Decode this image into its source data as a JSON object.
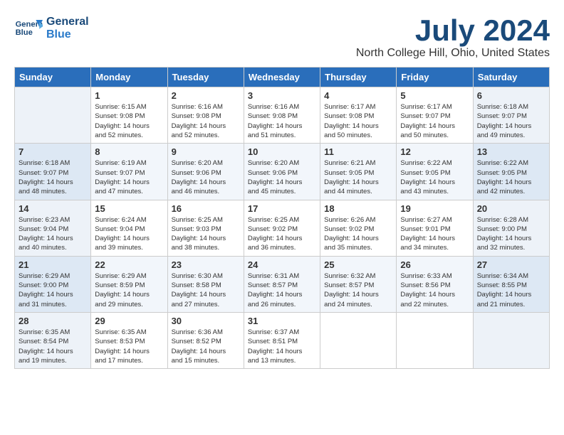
{
  "logo": {
    "line1": "General",
    "line2": "Blue"
  },
  "title": "July 2024",
  "subtitle": "North College Hill, Ohio, United States",
  "days": [
    "Sunday",
    "Monday",
    "Tuesday",
    "Wednesday",
    "Thursday",
    "Friday",
    "Saturday"
  ],
  "weeks": [
    [
      {
        "date": "",
        "info": ""
      },
      {
        "date": "1",
        "info": "Sunrise: 6:15 AM\nSunset: 9:08 PM\nDaylight: 14 hours\nand 52 minutes."
      },
      {
        "date": "2",
        "info": "Sunrise: 6:16 AM\nSunset: 9:08 PM\nDaylight: 14 hours\nand 52 minutes."
      },
      {
        "date": "3",
        "info": "Sunrise: 6:16 AM\nSunset: 9:08 PM\nDaylight: 14 hours\nand 51 minutes."
      },
      {
        "date": "4",
        "info": "Sunrise: 6:17 AM\nSunset: 9:08 PM\nDaylight: 14 hours\nand 50 minutes."
      },
      {
        "date": "5",
        "info": "Sunrise: 6:17 AM\nSunset: 9:07 PM\nDaylight: 14 hours\nand 50 minutes."
      },
      {
        "date": "6",
        "info": "Sunrise: 6:18 AM\nSunset: 9:07 PM\nDaylight: 14 hours\nand 49 minutes."
      }
    ],
    [
      {
        "date": "7",
        "info": "Sunrise: 6:18 AM\nSunset: 9:07 PM\nDaylight: 14 hours\nand 48 minutes."
      },
      {
        "date": "8",
        "info": "Sunrise: 6:19 AM\nSunset: 9:07 PM\nDaylight: 14 hours\nand 47 minutes."
      },
      {
        "date": "9",
        "info": "Sunrise: 6:20 AM\nSunset: 9:06 PM\nDaylight: 14 hours\nand 46 minutes."
      },
      {
        "date": "10",
        "info": "Sunrise: 6:20 AM\nSunset: 9:06 PM\nDaylight: 14 hours\nand 45 minutes."
      },
      {
        "date": "11",
        "info": "Sunrise: 6:21 AM\nSunset: 9:05 PM\nDaylight: 14 hours\nand 44 minutes."
      },
      {
        "date": "12",
        "info": "Sunrise: 6:22 AM\nSunset: 9:05 PM\nDaylight: 14 hours\nand 43 minutes."
      },
      {
        "date": "13",
        "info": "Sunrise: 6:22 AM\nSunset: 9:05 PM\nDaylight: 14 hours\nand 42 minutes."
      }
    ],
    [
      {
        "date": "14",
        "info": "Sunrise: 6:23 AM\nSunset: 9:04 PM\nDaylight: 14 hours\nand 40 minutes."
      },
      {
        "date": "15",
        "info": "Sunrise: 6:24 AM\nSunset: 9:04 PM\nDaylight: 14 hours\nand 39 minutes."
      },
      {
        "date": "16",
        "info": "Sunrise: 6:25 AM\nSunset: 9:03 PM\nDaylight: 14 hours\nand 38 minutes."
      },
      {
        "date": "17",
        "info": "Sunrise: 6:25 AM\nSunset: 9:02 PM\nDaylight: 14 hours\nand 36 minutes."
      },
      {
        "date": "18",
        "info": "Sunrise: 6:26 AM\nSunset: 9:02 PM\nDaylight: 14 hours\nand 35 minutes."
      },
      {
        "date": "19",
        "info": "Sunrise: 6:27 AM\nSunset: 9:01 PM\nDaylight: 14 hours\nand 34 minutes."
      },
      {
        "date": "20",
        "info": "Sunrise: 6:28 AM\nSunset: 9:00 PM\nDaylight: 14 hours\nand 32 minutes."
      }
    ],
    [
      {
        "date": "21",
        "info": "Sunrise: 6:29 AM\nSunset: 9:00 PM\nDaylight: 14 hours\nand 31 minutes."
      },
      {
        "date": "22",
        "info": "Sunrise: 6:29 AM\nSunset: 8:59 PM\nDaylight: 14 hours\nand 29 minutes."
      },
      {
        "date": "23",
        "info": "Sunrise: 6:30 AM\nSunset: 8:58 PM\nDaylight: 14 hours\nand 27 minutes."
      },
      {
        "date": "24",
        "info": "Sunrise: 6:31 AM\nSunset: 8:57 PM\nDaylight: 14 hours\nand 26 minutes."
      },
      {
        "date": "25",
        "info": "Sunrise: 6:32 AM\nSunset: 8:57 PM\nDaylight: 14 hours\nand 24 minutes."
      },
      {
        "date": "26",
        "info": "Sunrise: 6:33 AM\nSunset: 8:56 PM\nDaylight: 14 hours\nand 22 minutes."
      },
      {
        "date": "27",
        "info": "Sunrise: 6:34 AM\nSunset: 8:55 PM\nDaylight: 14 hours\nand 21 minutes."
      }
    ],
    [
      {
        "date": "28",
        "info": "Sunrise: 6:35 AM\nSunset: 8:54 PM\nDaylight: 14 hours\nand 19 minutes."
      },
      {
        "date": "29",
        "info": "Sunrise: 6:35 AM\nSunset: 8:53 PM\nDaylight: 14 hours\nand 17 minutes."
      },
      {
        "date": "30",
        "info": "Sunrise: 6:36 AM\nSunset: 8:52 PM\nDaylight: 14 hours\nand 15 minutes."
      },
      {
        "date": "31",
        "info": "Sunrise: 6:37 AM\nSunset: 8:51 PM\nDaylight: 14 hours\nand 13 minutes."
      },
      {
        "date": "",
        "info": ""
      },
      {
        "date": "",
        "info": ""
      },
      {
        "date": "",
        "info": ""
      }
    ]
  ]
}
